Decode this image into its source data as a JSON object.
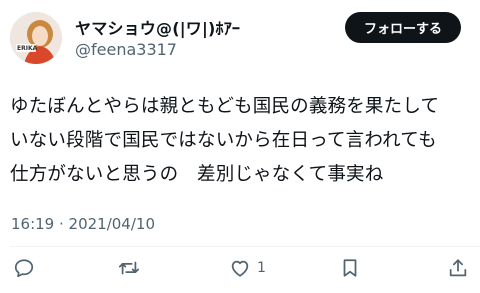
{
  "user": {
    "display_name": "ヤマショウ@(|ワ|)ﾎｱｰ",
    "handle": "@feena3317",
    "avatar_badge": "ERIKA"
  },
  "follow_button": {
    "label": "フォローする"
  },
  "tweet": {
    "lines": [
      "ゆたぼんとやらは親ともども国民の義務を果たして",
      "いない段階で国民ではないから在日って言われても",
      "仕方がないと思うの　差別じゃなくて事実ね"
    ],
    "timestamp": "16:19 · 2021/04/10"
  },
  "actions": {
    "reply": {
      "icon": "reply-icon"
    },
    "retweet": {
      "icon": "retweet-icon"
    },
    "like": {
      "icon": "heart-icon",
      "count": "1"
    },
    "bookmark": {
      "icon": "bookmark-icon"
    },
    "share": {
      "icon": "share-icon"
    }
  }
}
